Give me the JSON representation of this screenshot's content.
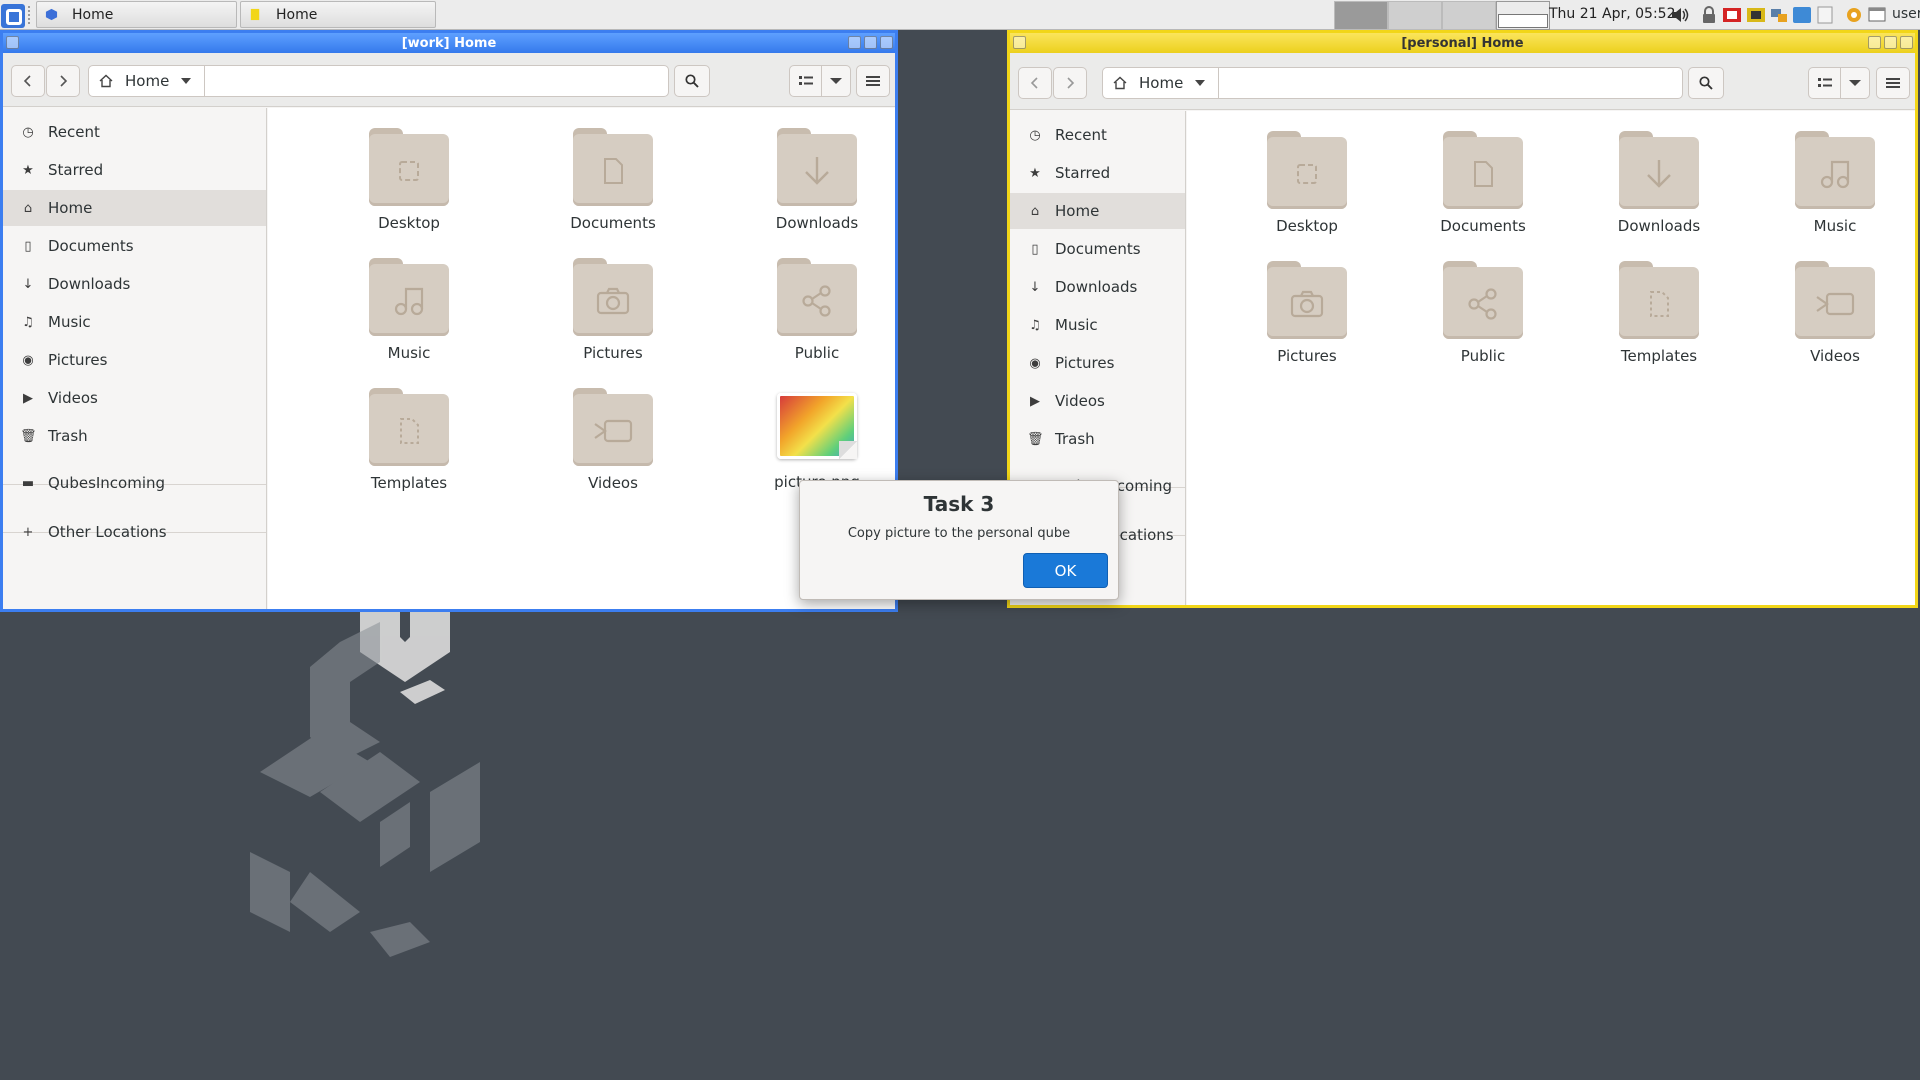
{
  "taskbar": {
    "tasks": [
      {
        "label": "Home",
        "qube": "work",
        "color": "#3c7ef0"
      },
      {
        "label": "Home",
        "qube": "personal",
        "color": "#f2d618"
      }
    ],
    "clock": "Thu 21 Apr, 05:52",
    "user": "user",
    "tray_icons": [
      "volume-icon",
      "lock-icon",
      "red-qube-icon",
      "yellow-qube-icon",
      "network-icon",
      "blue-qube-icon",
      "notes-icon",
      "gear-icon",
      "window-icon"
    ]
  },
  "work_window": {
    "title": "[work] Home",
    "accent": "#3c7ef0",
    "location": "Home",
    "sidebar": [
      {
        "label": "Recent",
        "icon": "clock-icon"
      },
      {
        "label": "Starred",
        "icon": "star-icon"
      },
      {
        "label": "Home",
        "icon": "home-icon",
        "selected": true
      },
      {
        "label": "Documents",
        "icon": "document-icon"
      },
      {
        "label": "Downloads",
        "icon": "download-icon"
      },
      {
        "label": "Music",
        "icon": "music-icon"
      },
      {
        "label": "Pictures",
        "icon": "camera-icon"
      },
      {
        "label": "Videos",
        "icon": "video-icon"
      },
      {
        "label": "Trash",
        "icon": "trash-icon"
      },
      {
        "label": "QubesIncoming",
        "icon": "folder-icon"
      },
      {
        "label": "Other Locations",
        "icon": "plus-icon"
      }
    ],
    "files": [
      {
        "label": "Desktop",
        "icon": "desktop-icon"
      },
      {
        "label": "Documents",
        "icon": "document-icon"
      },
      {
        "label": "Downloads",
        "icon": "download-icon"
      },
      {
        "label": "Music",
        "icon": "music-icon"
      },
      {
        "label": "Pictures",
        "icon": "camera-icon"
      },
      {
        "label": "Public",
        "icon": "share-icon"
      },
      {
        "label": "Templates",
        "icon": "template-icon"
      },
      {
        "label": "Videos",
        "icon": "video-icon"
      },
      {
        "label": "picture.png",
        "icon": "image-thumbnail"
      }
    ]
  },
  "personal_window": {
    "title": "[personal] Home",
    "accent": "#f2d618",
    "location": "Home",
    "sidebar": [
      {
        "label": "Recent",
        "icon": "clock-icon"
      },
      {
        "label": "Starred",
        "icon": "star-icon"
      },
      {
        "label": "Home",
        "icon": "home-icon",
        "selected": true
      },
      {
        "label": "Documents",
        "icon": "document-icon"
      },
      {
        "label": "Downloads",
        "icon": "download-icon"
      },
      {
        "label": "Music",
        "icon": "music-icon"
      },
      {
        "label": "Pictures",
        "icon": "camera-icon"
      },
      {
        "label": "Videos",
        "icon": "video-icon"
      },
      {
        "label": "Trash",
        "icon": "trash-icon"
      },
      {
        "label": "QubesIncoming",
        "icon": "folder-icon"
      },
      {
        "label": "Other Locations",
        "icon": "plus-icon"
      }
    ],
    "files": [
      {
        "label": "Desktop",
        "icon": "desktop-icon"
      },
      {
        "label": "Documents",
        "icon": "document-icon"
      },
      {
        "label": "Downloads",
        "icon": "download-icon"
      },
      {
        "label": "Music",
        "icon": "music-icon"
      },
      {
        "label": "Pictures",
        "icon": "camera-icon"
      },
      {
        "label": "Public",
        "icon": "share-icon"
      },
      {
        "label": "Templates",
        "icon": "template-icon"
      },
      {
        "label": "Videos",
        "icon": "video-icon"
      }
    ]
  },
  "dialog": {
    "title": "Task 3",
    "message": "Copy picture to the personal qube",
    "ok_label": "OK",
    "button_color": "#1a79d8"
  }
}
